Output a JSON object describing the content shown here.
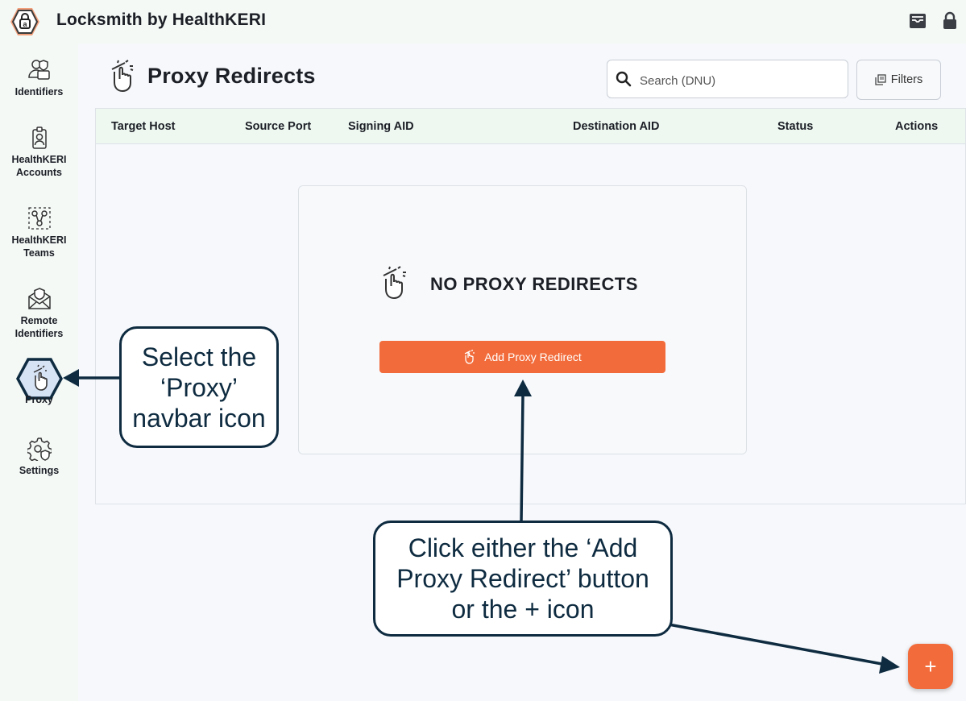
{
  "app": {
    "title": "Locksmith by HealthKERI"
  },
  "topbar": {
    "icons": [
      "inbox-icon",
      "lock-icon"
    ]
  },
  "sidebar": {
    "items": [
      {
        "label_lines": [
          "Identifiers"
        ],
        "icon": "identifiers-icon"
      },
      {
        "label_lines": [
          "HealthKERI",
          "Accounts"
        ],
        "icon": "badge-icon"
      },
      {
        "label_lines": [
          "HealthKERI",
          "Teams"
        ],
        "icon": "network-icon"
      },
      {
        "label_lines": [
          "Remote",
          "Identifiers"
        ],
        "icon": "remote-identifier-icon"
      },
      {
        "label_lines": [
          "Proxy"
        ],
        "icon": "proxy-icon",
        "active": true
      },
      {
        "label_lines": [
          "Settings"
        ],
        "icon": "settings-icon"
      }
    ]
  },
  "page": {
    "title": "Proxy Redirects"
  },
  "search": {
    "placeholder": "Search (DNU)"
  },
  "filters": {
    "label": "Filters"
  },
  "table": {
    "columns": [
      "Target Host",
      "Source Port",
      "Signing AID",
      "Destination AID",
      "Status",
      "Actions"
    ]
  },
  "empty_state": {
    "title": "NO PROXY REDIRECTS",
    "button_label": "Add Proxy Redirect"
  },
  "fab": {
    "label": "+"
  },
  "callouts": {
    "proxy_lines": [
      "Select the",
      "‘Proxy’",
      "navbar icon"
    ],
    "add_lines": [
      "Click either the ‘Add",
      "Proxy Redirect’ button",
      "or the + icon"
    ]
  },
  "colors": {
    "accent": "#f26b3a",
    "callout_border": "#0e2b40",
    "header_bg": "#eef8f1"
  }
}
